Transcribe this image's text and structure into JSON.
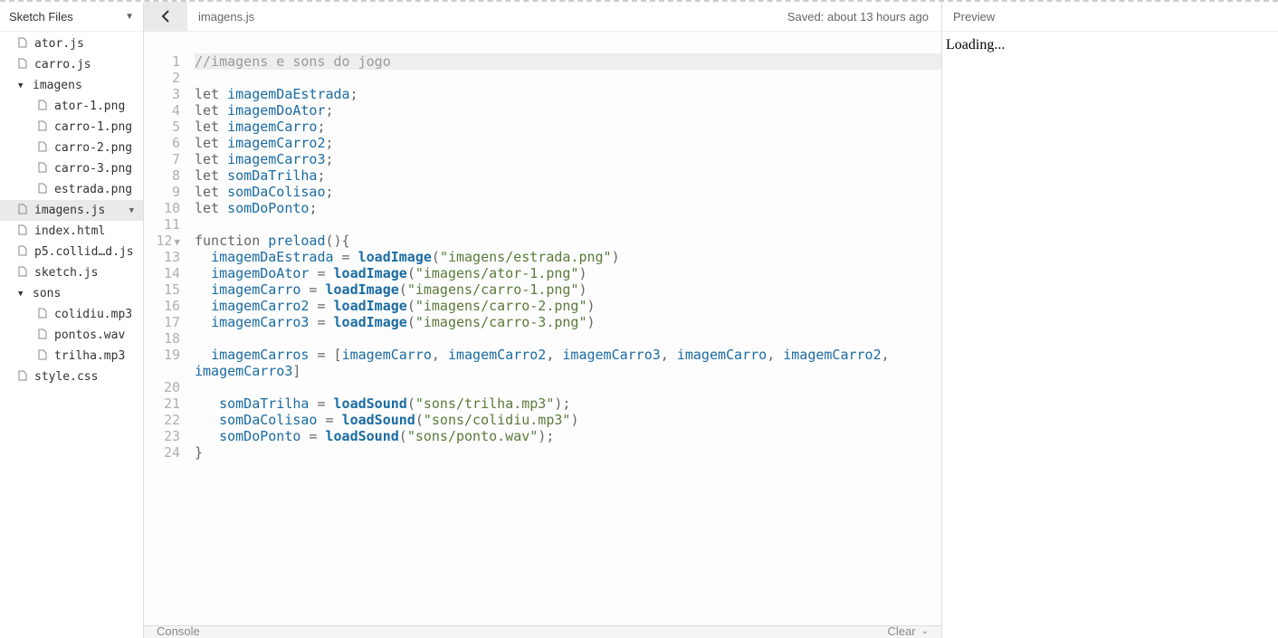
{
  "sidebar": {
    "title": "Sketch Files",
    "files": [
      {
        "name": "ator.js",
        "type": "file",
        "nested": false
      },
      {
        "name": "carro.js",
        "type": "file",
        "nested": false
      },
      {
        "name": "imagens",
        "type": "folder",
        "nested": false
      },
      {
        "name": "ator-1.png",
        "type": "file",
        "nested": true
      },
      {
        "name": "carro-1.png",
        "type": "file",
        "nested": true
      },
      {
        "name": "carro-2.png",
        "type": "file",
        "nested": true
      },
      {
        "name": "carro-3.png",
        "type": "file",
        "nested": true
      },
      {
        "name": "estrada.png",
        "type": "file",
        "nested": true
      },
      {
        "name": "imagens.js",
        "type": "file",
        "nested": false,
        "selected": true
      },
      {
        "name": "index.html",
        "type": "file",
        "nested": false
      },
      {
        "name": "p5.collid…d.js",
        "type": "file",
        "nested": false
      },
      {
        "name": "sketch.js",
        "type": "file",
        "nested": false
      },
      {
        "name": "sons",
        "type": "folder",
        "nested": false
      },
      {
        "name": "colidiu.mp3",
        "type": "file",
        "nested": true
      },
      {
        "name": "pontos.wav",
        "type": "file",
        "nested": true
      },
      {
        "name": "trilha.mp3",
        "type": "file",
        "nested": true
      },
      {
        "name": "style.css",
        "type": "file",
        "nested": false
      }
    ]
  },
  "editor": {
    "filename": "imagens.js",
    "saved_status": "Saved: about 13 hours ago",
    "line_count": 24,
    "fold_marker_line": 12,
    "highlighted_line": 1,
    "code": [
      {
        "tokens": [
          {
            "t": "//imagens e sons do jogo",
            "c": "comment"
          }
        ]
      },
      {
        "tokens": []
      },
      {
        "tokens": [
          {
            "t": "let ",
            "c": "keyword"
          },
          {
            "t": "imagemDaEstrada",
            "c": "variable"
          },
          {
            "t": ";",
            "c": "punct"
          }
        ]
      },
      {
        "tokens": [
          {
            "t": "let ",
            "c": "keyword"
          },
          {
            "t": "imagemDoAtor",
            "c": "variable"
          },
          {
            "t": ";",
            "c": "punct"
          }
        ]
      },
      {
        "tokens": [
          {
            "t": "let ",
            "c": "keyword"
          },
          {
            "t": "imagemCarro",
            "c": "variable"
          },
          {
            "t": ";",
            "c": "punct"
          }
        ]
      },
      {
        "tokens": [
          {
            "t": "let ",
            "c": "keyword"
          },
          {
            "t": "imagemCarro2",
            "c": "variable"
          },
          {
            "t": ";",
            "c": "punct"
          }
        ]
      },
      {
        "tokens": [
          {
            "t": "let ",
            "c": "keyword"
          },
          {
            "t": "imagemCarro3",
            "c": "variable"
          },
          {
            "t": ";",
            "c": "punct"
          }
        ]
      },
      {
        "tokens": [
          {
            "t": "let ",
            "c": "keyword"
          },
          {
            "t": "somDaTrilha",
            "c": "variable"
          },
          {
            "t": ";",
            "c": "punct"
          }
        ]
      },
      {
        "tokens": [
          {
            "t": "let ",
            "c": "keyword"
          },
          {
            "t": "somDaColisao",
            "c": "variable"
          },
          {
            "t": ";",
            "c": "punct"
          }
        ]
      },
      {
        "tokens": [
          {
            "t": "let ",
            "c": "keyword"
          },
          {
            "t": "somDoPonto",
            "c": "variable"
          },
          {
            "t": ";",
            "c": "punct"
          }
        ]
      },
      {
        "tokens": []
      },
      {
        "tokens": [
          {
            "t": "function ",
            "c": "keyword"
          },
          {
            "t": "preload",
            "c": "variable"
          },
          {
            "t": "(){",
            "c": "punct"
          }
        ]
      },
      {
        "tokens": [
          {
            "t": "  ",
            "c": ""
          },
          {
            "t": "imagemDaEstrada",
            "c": "variable"
          },
          {
            "t": " = ",
            "c": "punct"
          },
          {
            "t": "loadImage",
            "c": "function"
          },
          {
            "t": "(",
            "c": "punct"
          },
          {
            "t": "\"imagens/estrada.png\"",
            "c": "string"
          },
          {
            "t": ")",
            "c": "punct"
          }
        ]
      },
      {
        "tokens": [
          {
            "t": "  ",
            "c": ""
          },
          {
            "t": "imagemDoAtor",
            "c": "variable"
          },
          {
            "t": " = ",
            "c": "punct"
          },
          {
            "t": "loadImage",
            "c": "function"
          },
          {
            "t": "(",
            "c": "punct"
          },
          {
            "t": "\"imagens/ator-1.png\"",
            "c": "string"
          },
          {
            "t": ")",
            "c": "punct"
          }
        ]
      },
      {
        "tokens": [
          {
            "t": "  ",
            "c": ""
          },
          {
            "t": "imagemCarro",
            "c": "variable"
          },
          {
            "t": " = ",
            "c": "punct"
          },
          {
            "t": "loadImage",
            "c": "function"
          },
          {
            "t": "(",
            "c": "punct"
          },
          {
            "t": "\"imagens/carro-1.png\"",
            "c": "string"
          },
          {
            "t": ")",
            "c": "punct"
          }
        ]
      },
      {
        "tokens": [
          {
            "t": "  ",
            "c": ""
          },
          {
            "t": "imagemCarro2",
            "c": "variable"
          },
          {
            "t": " = ",
            "c": "punct"
          },
          {
            "t": "loadImage",
            "c": "function"
          },
          {
            "t": "(",
            "c": "punct"
          },
          {
            "t": "\"imagens/carro-2.png\"",
            "c": "string"
          },
          {
            "t": ")",
            "c": "punct"
          }
        ]
      },
      {
        "tokens": [
          {
            "t": "  ",
            "c": ""
          },
          {
            "t": "imagemCarro3",
            "c": "variable"
          },
          {
            "t": " = ",
            "c": "punct"
          },
          {
            "t": "loadImage",
            "c": "function"
          },
          {
            "t": "(",
            "c": "punct"
          },
          {
            "t": "\"imagens/carro-3.png\"",
            "c": "string"
          },
          {
            "t": ")",
            "c": "punct"
          }
        ]
      },
      {
        "tokens": []
      },
      {
        "tokens": [
          {
            "t": "  ",
            "c": ""
          },
          {
            "t": "imagemCarros",
            "c": "variable"
          },
          {
            "t": " = [",
            "c": "punct"
          },
          {
            "t": "imagemCarro",
            "c": "variable"
          },
          {
            "t": ", ",
            "c": "punct"
          },
          {
            "t": "imagemCarro2",
            "c": "variable"
          },
          {
            "t": ", ",
            "c": "punct"
          },
          {
            "t": "imagemCarro3",
            "c": "variable"
          },
          {
            "t": ", ",
            "c": "punct"
          },
          {
            "t": "imagemCarro",
            "c": "variable"
          },
          {
            "t": ", ",
            "c": "punct"
          },
          {
            "t": "imagemCarro2",
            "c": "variable"
          },
          {
            "t": ", ",
            "c": "punct"
          }
        ]
      },
      {
        "tokens": [
          {
            "t": "imagemCarro3",
            "c": "variable"
          },
          {
            "t": "]",
            "c": "punct"
          }
        ]
      },
      {
        "tokens": []
      },
      {
        "tokens": [
          {
            "t": "   ",
            "c": ""
          },
          {
            "t": "somDaTrilha",
            "c": "variable"
          },
          {
            "t": " = ",
            "c": "punct"
          },
          {
            "t": "loadSound",
            "c": "function"
          },
          {
            "t": "(",
            "c": "punct"
          },
          {
            "t": "\"sons/trilha.mp3\"",
            "c": "string"
          },
          {
            "t": ");",
            "c": "punct"
          }
        ]
      },
      {
        "tokens": [
          {
            "t": "   ",
            "c": ""
          },
          {
            "t": "somDaColisao",
            "c": "variable"
          },
          {
            "t": " = ",
            "c": "punct"
          },
          {
            "t": "loadSound",
            "c": "function"
          },
          {
            "t": "(",
            "c": "punct"
          },
          {
            "t": "\"sons/colidiu.mp3\"",
            "c": "string"
          },
          {
            "t": ")",
            "c": "punct"
          }
        ]
      },
      {
        "tokens": [
          {
            "t": "   ",
            "c": ""
          },
          {
            "t": "somDoPonto",
            "c": "variable"
          },
          {
            "t": " = ",
            "c": "punct"
          },
          {
            "t": "loadSound",
            "c": "function"
          },
          {
            "t": "(",
            "c": "punct"
          },
          {
            "t": "\"sons/ponto.wav\"",
            "c": "string"
          },
          {
            "t": ");",
            "c": "punct"
          }
        ]
      },
      {
        "tokens": [
          {
            "t": "}",
            "c": "punct"
          }
        ]
      }
    ]
  },
  "console": {
    "label": "Console",
    "clear_label": "Clear"
  },
  "preview": {
    "title": "Preview",
    "content": "Loading..."
  }
}
